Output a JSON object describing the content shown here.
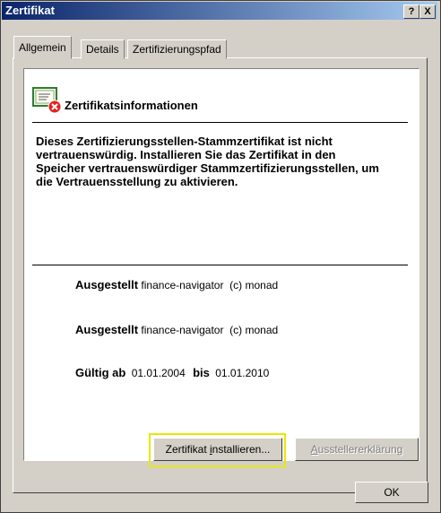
{
  "window": {
    "title": "Zertifikat",
    "help_btn": "?",
    "close_btn": "X"
  },
  "tabs": [
    {
      "label": "Allgemein",
      "active": true
    },
    {
      "label": "Details",
      "active": false
    },
    {
      "label": "Zertifizierungspfad",
      "active": false
    }
  ],
  "info": {
    "heading": "Zertifikatsinformationen",
    "description": "Dieses Zertifizierungsstellen-Stammzertifikat ist nicht vertrauenswürdig. Installieren Sie das Zertifikat in den Speicher vertrauenswürdiger Stammzertifizierungsstellen, um die Vertrauensstellung zu aktivieren.",
    "issued_to_label": "Ausgestellt",
    "issued_to_value": "finance-navigator  (c) monad",
    "issued_by_label": "Ausgestellt",
    "issued_by_value": "finance-navigator  (c) monad",
    "valid_from_label": "Gültig ab",
    "valid_from": "01.01.2004",
    "valid_to_label": "bis",
    "valid_to": "01.01.2010"
  },
  "buttons": {
    "install_pre": "Zertifikat ",
    "install_key": "i",
    "install_post": "nstallieren...",
    "issuer_key": "A",
    "issuer_post": "usstellererklärung",
    "ok": "OK"
  },
  "colors": {
    "titlebar_start": "#0a246a",
    "titlebar_end": "#a6caf0",
    "highlight": "#e8e800"
  },
  "icons": {
    "certificate": "certificate-error-icon"
  }
}
